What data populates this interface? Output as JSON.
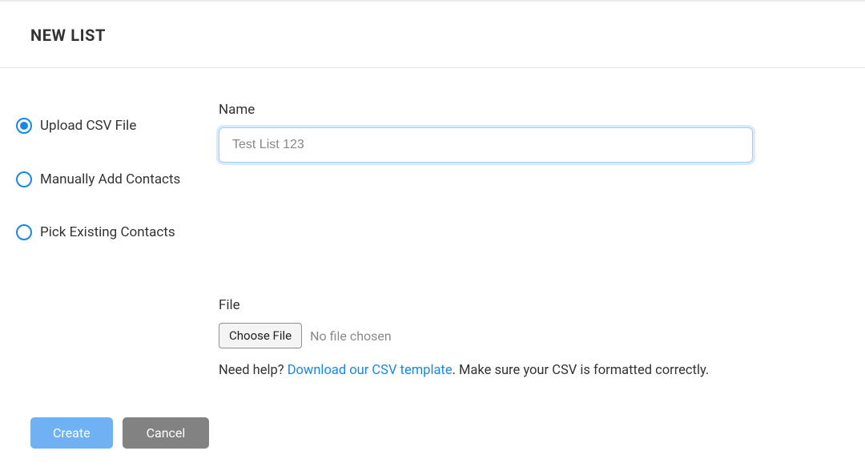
{
  "header": {
    "title": "NEW LIST"
  },
  "sidebar": {
    "options": [
      {
        "label": "Upload CSV File",
        "selected": true
      },
      {
        "label": "Manually Add Contacts",
        "selected": false
      },
      {
        "label": "Pick Existing Contacts",
        "selected": false
      }
    ]
  },
  "form": {
    "name_label": "Name",
    "name_value": "Test List 123",
    "file_label": "File",
    "choose_file_label": "Choose File",
    "no_file_text": "No file chosen",
    "help_prefix": "Need help? ",
    "help_link_text": "Download our CSV template",
    "help_suffix": ". Make sure your CSV is formatted correctly."
  },
  "footer": {
    "create_label": "Create",
    "cancel_label": "Cancel"
  },
  "colors": {
    "accent": "#1b87e5",
    "primary_button": "#6fb1f2",
    "secondary_button": "#828282"
  }
}
